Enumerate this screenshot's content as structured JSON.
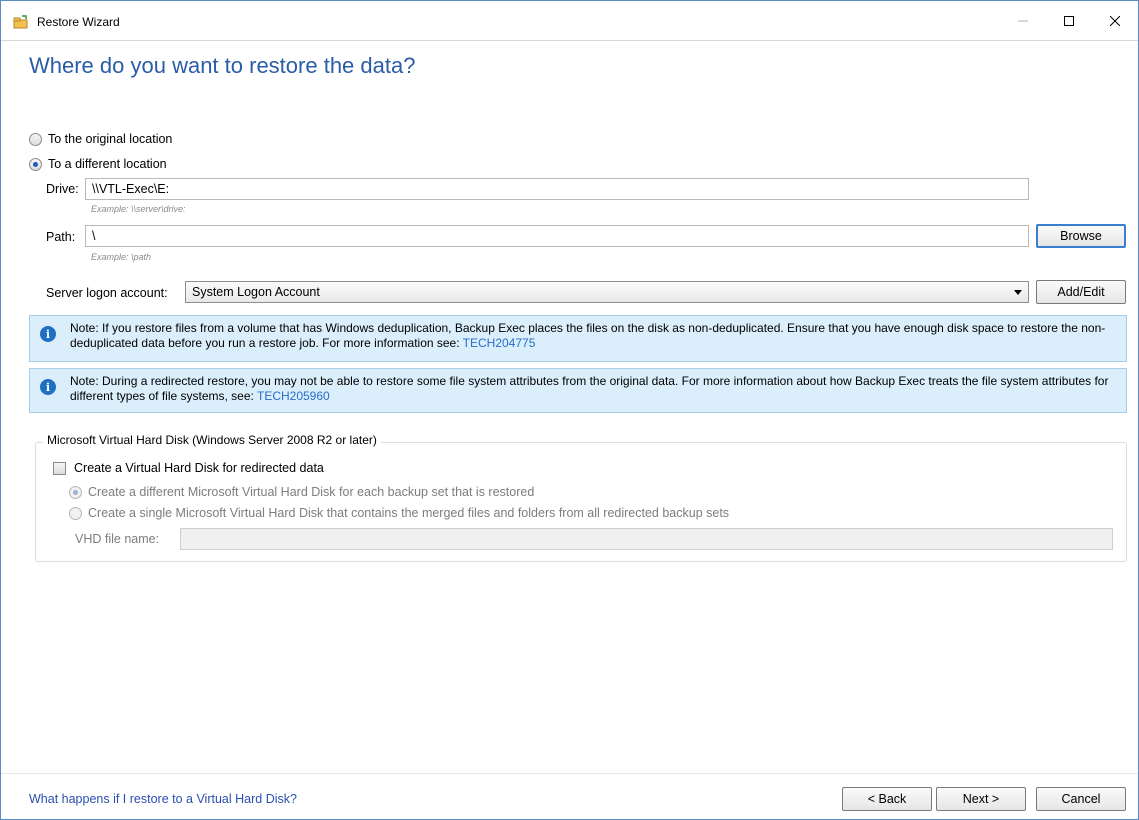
{
  "window": {
    "title": "Restore Wizard"
  },
  "page": {
    "heading": "Where do you want to restore the data?"
  },
  "location": {
    "original_label": "To the original location",
    "different_label": "To a different location",
    "selected": "different"
  },
  "drive": {
    "label": "Drive:",
    "value": "\\\\VTL-Exec\\E:",
    "example": "Example: \\\\server\\drive:"
  },
  "path": {
    "label": "Path:",
    "value": "\\",
    "example": "Example: \\path",
    "browse_label": "Browse"
  },
  "logon": {
    "label": "Server logon account:",
    "selected": "System Logon Account",
    "add_edit_label": "Add/Edit"
  },
  "notes": [
    {
      "text": "Note: If you restore files from a volume that has Windows deduplication, Backup Exec places the files on the disk as non-deduplicated. Ensure that you have enough disk space to restore the non-deduplicated data before you run a restore job. For more information see: ",
      "link": "TECH204775"
    },
    {
      "text": "Note: During a redirected restore, you may not be able to restore some file system attributes from the original data. For more information about how Backup Exec treats the file system attributes for different types of file systems, see: ",
      "link": "TECH205960"
    }
  ],
  "vhd": {
    "group_title": "Microsoft Virtual Hard Disk (Windows Server 2008 R2 or later)",
    "create_label": "Create a Virtual Hard Disk for redirected data",
    "create_checked": false,
    "option_each_label": "Create a different Microsoft Virtual Hard Disk for each backup set that is restored",
    "option_single_label": "Create a single Microsoft Virtual Hard Disk that contains the merged files and folders from all redirected backup sets",
    "file_name_label": "VHD file name:",
    "file_name_value": ""
  },
  "footer": {
    "help_link": "What happens if I restore to a Virtual Hard Disk?",
    "back_label": "< Back",
    "next_label": "Next >",
    "cancel_label": "Cancel"
  }
}
